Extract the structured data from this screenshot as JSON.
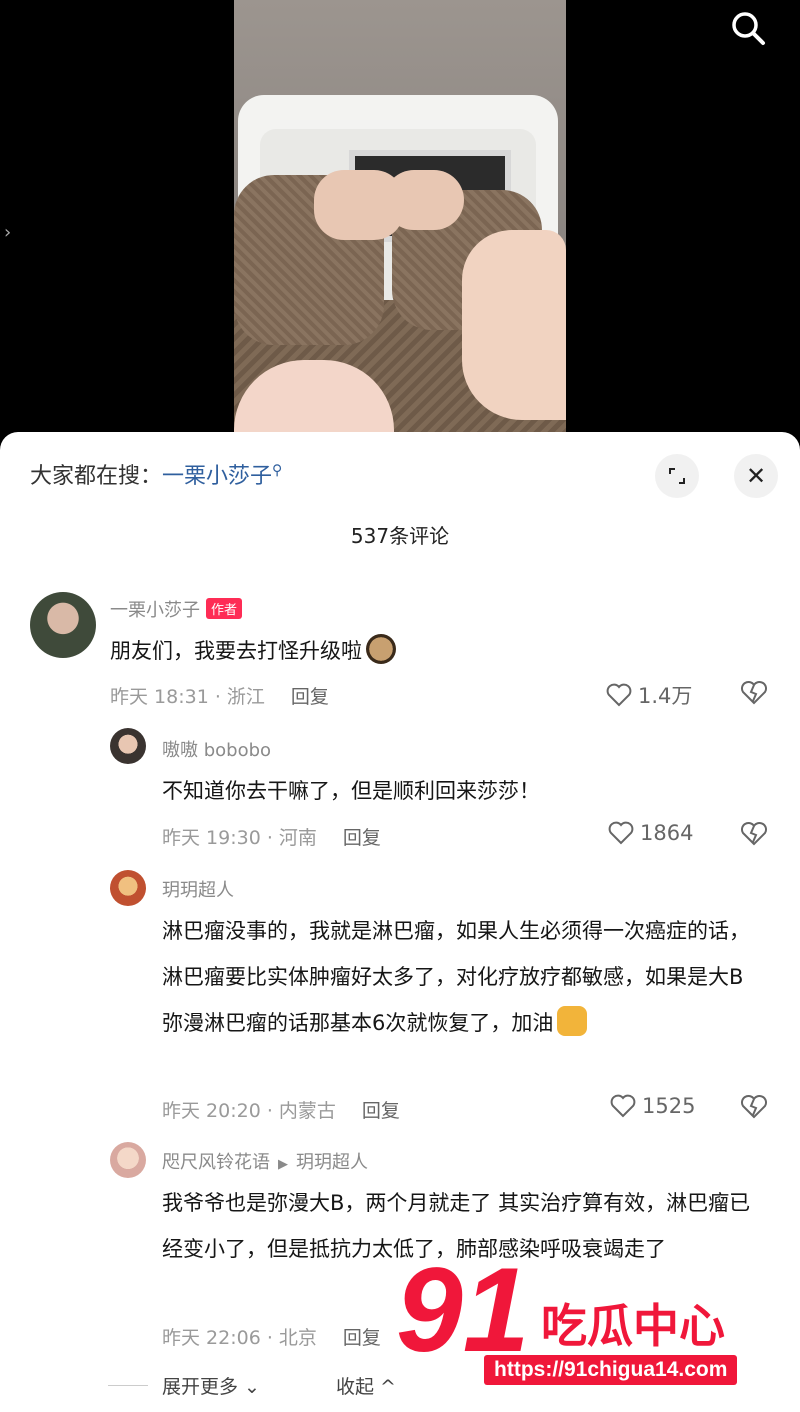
{
  "header": {
    "search_keyword_prefix": "大家都在搜：",
    "search_keyword": "一栗小莎子"
  },
  "comments_count": "537条评论",
  "comments": [
    {
      "user": "一栗小莎子",
      "badge": "作者",
      "text": "朋友们，我要去打怪升级啦",
      "time_loc": "昨天 18:31 · 浙江",
      "reply": "回复",
      "likes": "1.4万"
    },
    {
      "user": "嗷嗷 bobobo",
      "text": "不知道你去干嘛了，但是顺利回来莎莎！",
      "time_loc": "昨天 19:30 · 河南",
      "reply": "回复",
      "likes": "1864"
    },
    {
      "user": "玥玥超人",
      "text": "淋巴瘤没事的，我就是淋巴瘤，如果人生必须得一次癌症的话，淋巴瘤要比实体肿瘤好太多了，对化疗放疗都敏感，如果是大B弥漫淋巴瘤的话那基本6次就恢复了，加油",
      "time_loc": "昨天 20:20 · 内蒙古",
      "reply": "回复",
      "likes": "1525"
    },
    {
      "user": "咫尺风铃花语",
      "reply_to": "玥玥超人",
      "text": "我爷爷也是弥漫大B，两个月就走了 其实治疗算有效，淋巴瘤已经变小了，但是抵抗力太低了，肺部感染呼吸衰竭走了",
      "time_loc": "昨天 22:06 · 北京",
      "reply": "回复"
    }
  ],
  "footer": {
    "expand": "展开更多",
    "collapse": "收起"
  },
  "watermark": {
    "big": "91",
    "text": "吃瓜中心",
    "url": "https://91chigua14.com"
  }
}
